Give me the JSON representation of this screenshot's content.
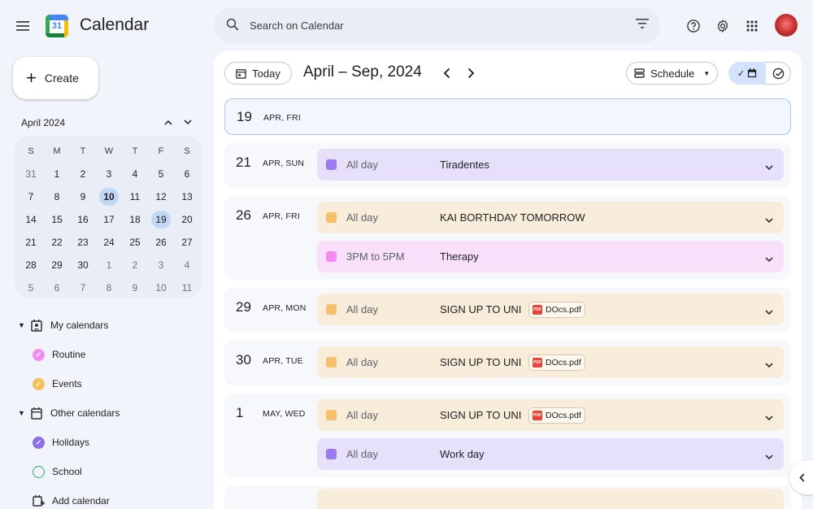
{
  "app": {
    "name": "Calendar",
    "logo_number": "31"
  },
  "search": {
    "placeholder": "Search on Calendar"
  },
  "sidebar": {
    "create_label": "Create",
    "mini_calendar": {
      "month_label": "April 2024",
      "weekdays": [
        "S",
        "M",
        "T",
        "W",
        "T",
        "F",
        "S"
      ],
      "weeks": [
        [
          "31",
          "1",
          "2",
          "3",
          "4",
          "5",
          "6"
        ],
        [
          "7",
          "8",
          "9",
          "10",
          "11",
          "12",
          "13"
        ],
        [
          "14",
          "15",
          "16",
          "17",
          "18",
          "19",
          "20"
        ],
        [
          "21",
          "22",
          "23",
          "24",
          "25",
          "26",
          "27"
        ],
        [
          "28",
          "29",
          "30",
          "1",
          "2",
          "3",
          "4"
        ],
        [
          "5",
          "6",
          "7",
          "8",
          "9",
          "10",
          "11"
        ]
      ],
      "selected_day": "10",
      "highlighted_day": "19"
    },
    "my_calendars": {
      "label": "My calendars",
      "items": [
        {
          "name": "Routine",
          "color": "#f28bf2"
        },
        {
          "name": "Events",
          "color": "#f6bf5a"
        }
      ]
    },
    "other_calendars": {
      "label": "Other calendars",
      "items": [
        {
          "name": "Holidays",
          "color": "#8e6ee8"
        },
        {
          "name": "School",
          "color": "#34a853"
        }
      ]
    },
    "add_calendar_label": "Add calendar"
  },
  "toolbar": {
    "today_label": "Today",
    "range_label": "April – Sep, 2024",
    "view_label": "Schedule"
  },
  "colors": {
    "purple_bg": "#e6e0fb",
    "purple_sq": "#9a7bf0",
    "orange_bg": "#f8ecdb",
    "orange_sq": "#f6bf6a",
    "pink_bg": "#f9e0fa",
    "pink_sq": "#f28bf2"
  },
  "days": [
    {
      "num": "19",
      "label": "APR, FRI",
      "events": []
    },
    {
      "num": "21",
      "label": "APR, SUN",
      "events": [
        {
          "time": "All day",
          "title": "Tiradentes",
          "color": "purple"
        }
      ]
    },
    {
      "num": "26",
      "label": "APR, FRI",
      "events": [
        {
          "time": "All day",
          "title": "KAI BORTHDAY TOMORROW",
          "color": "orange"
        },
        {
          "time": "3PM to 5PM",
          "title": "Therapy",
          "color": "pink"
        }
      ]
    },
    {
      "num": "29",
      "label": "APR, MON",
      "events": [
        {
          "time": "All day",
          "title": "SIGN UP TO UNI",
          "color": "orange",
          "attachment": "DOcs.pdf"
        }
      ]
    },
    {
      "num": "30",
      "label": "APR, TUE",
      "events": [
        {
          "time": "All day",
          "title": "SIGN UP TO UNI",
          "color": "orange",
          "attachment": "DOcs.pdf"
        }
      ]
    },
    {
      "num": "1",
      "label": "MAY, WED",
      "events": [
        {
          "time": "All day",
          "title": "SIGN UP TO UNI",
          "color": "orange",
          "attachment": "DOcs.pdf"
        },
        {
          "time": "All day",
          "title": "Work day",
          "color": "purple"
        }
      ]
    }
  ]
}
